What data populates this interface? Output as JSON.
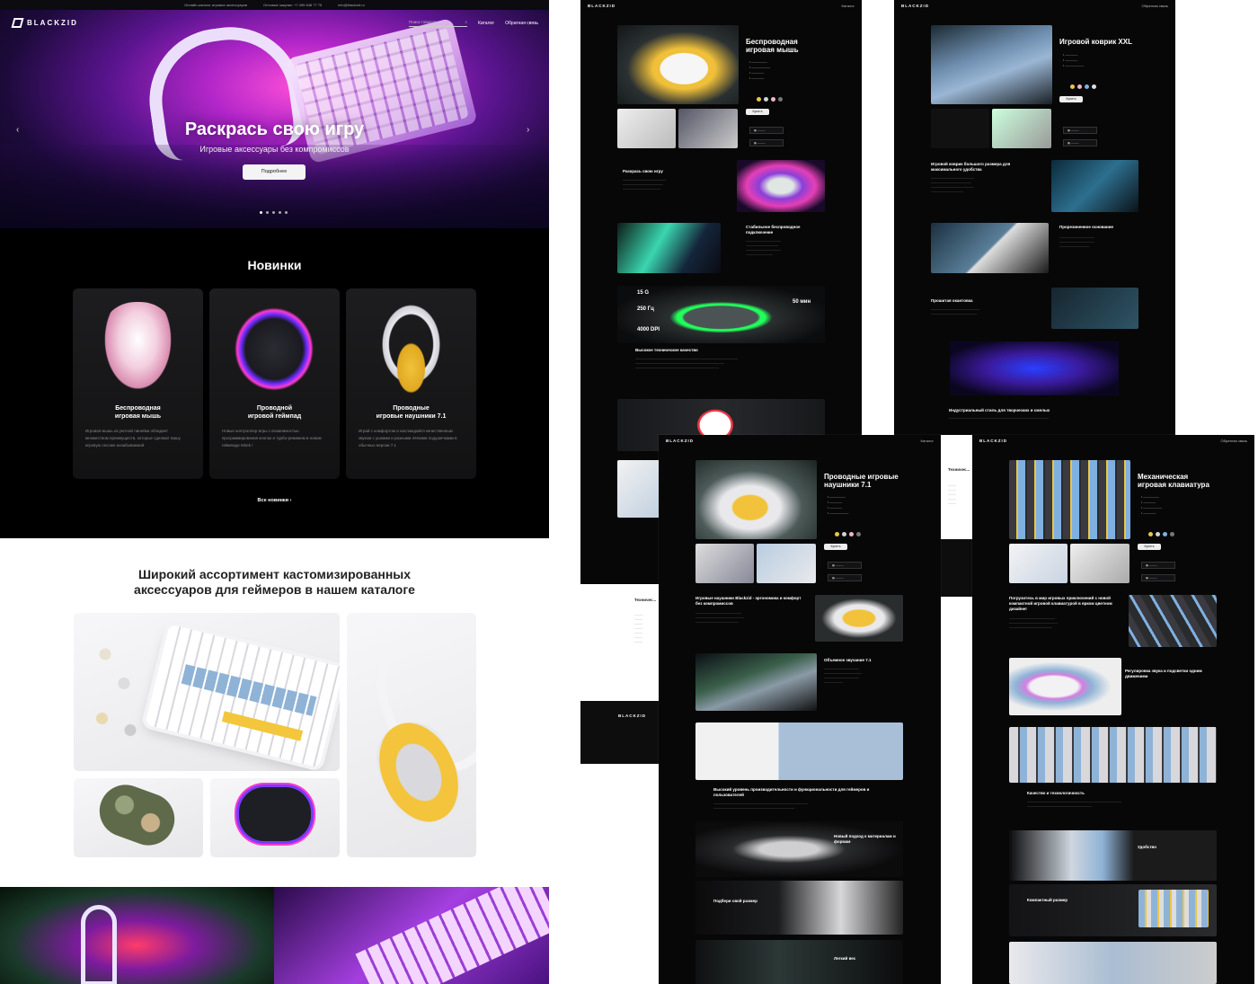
{
  "home": {
    "topbar": {
      "items": [
        "Онлайн-каталог игровых аксессуаров",
        "Оптовые закупки: +7 495 648 77 75",
        "info@blackzid.ru"
      ]
    },
    "brand": "BLACKZID",
    "search_placeholder": "Поиск товаров",
    "nav": [
      "Каталог",
      "Обратная связь"
    ],
    "hero": {
      "title": "Раскрась свою игру",
      "subtitle": "Игровые аксессуары без компромиссов",
      "button": "Подробнее",
      "slides": 5,
      "active_slide": 1
    },
    "new_section": {
      "title": "Новинки",
      "cards": [
        {
          "title": "Беспроводная\nигровая мышь",
          "desc": "Игровая мышь из уютной линейки обладает множеством преимуществ, которые сделают вашу игровую сессию незабываемой"
        },
        {
          "title": "Проводной\nигровой геймпад",
          "desc": "Новые контроллер игры с возможностью программирования кнопок и турбо-режимом в новом геймпаде Mirek !"
        },
        {
          "title": "Проводные\nигровые наушники 7.1",
          "desc": "Играй с комфортом и наслаждайся качественным звуком с ушками и разными лёгкими подушечками в обычных версии 7.1"
        }
      ],
      "all_link": "Все новинки"
    },
    "catalog_section": {
      "title": "Широкий ассортимент кастомизированных\nаксессуаров для геймеров в нашем каталоге"
    }
  },
  "sheets": {
    "mouse": {
      "title": "Беспроводная\nигровая мышь",
      "button": "Купить",
      "sec1": "Раскрась свою игру",
      "sec2": "Стабильное беспроводное подключение",
      "stats": [
        "15 G",
        "250 Гц",
        "4000 DPI",
        "50 мин"
      ],
      "sec3": "Высокое техническое качество"
    },
    "mat": {
      "title": "Игровой коврик XXL",
      "button": "Купить",
      "sec1": "Игровой коврик большого размера для максимального удобства",
      "sec2": "Прорезиненное основание",
      "sec3": "Прошитая окантовка",
      "sec4": "Индустриальный стиль для творческих и смелых",
      "tech": "Техничес..."
    },
    "headphones": {
      "title": "Проводные игровые\nнаушники 7.1",
      "button": "Купить",
      "sec1": "Игровые наушники Blackzid - эргономика и комфорт без компромиссов",
      "sec2": "Объемное звучание 7.1",
      "sec3": "Высокий уровень производительности и функциональности для геймеров и пользователей",
      "sec4": "Новый подход к материалам и формам",
      "sec5": "Подбери свой размер",
      "sec6": "Легкий вес",
      "tech": "Техничес..."
    },
    "keyboard": {
      "title": "Механическая\nигровая клавиатура",
      "button": "Купить",
      "sec1": "Погрузитесь в мир игровых приключений с новой компактной игровой клавиатурой в ярком цветном дизайне!",
      "sec2": "Регулировка звука и подсветки одним движением",
      "sec3": "Качество и технологичность",
      "sec4": "Удобство",
      "sec5": "Компактный размер"
    }
  }
}
